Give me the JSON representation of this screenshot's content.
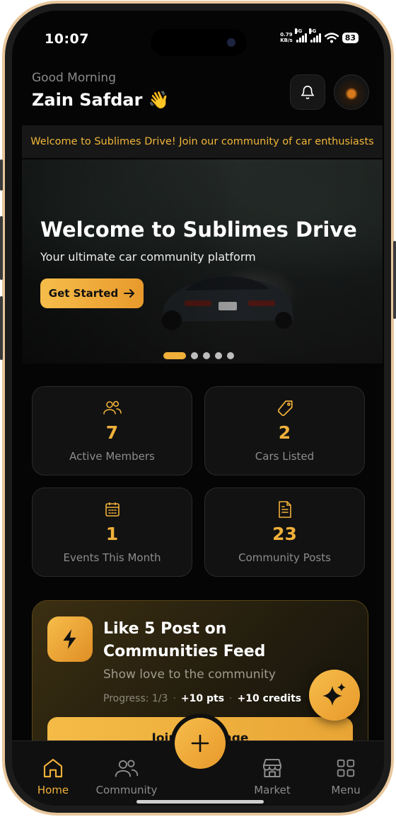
{
  "status_bar": {
    "time": "10:07",
    "speed_value": "0.79",
    "speed_unit": "KB/s",
    "network_1": "4G",
    "network_2": "4G",
    "battery": "83"
  },
  "header": {
    "greeting": "Good Morning",
    "user_name": "Zain Safdar 👋"
  },
  "ticker": {
    "text": "Welcome to Sublimes Drive! Join our community of car enthusiasts"
  },
  "hero": {
    "title": "Welcome to Sublimes Drive",
    "subtitle": "Your ultimate car community platform",
    "cta_label": "Get Started",
    "slide_count": 5,
    "active_slide": 1
  },
  "stats": [
    {
      "value": "7",
      "label": "Active Members",
      "icon": "users-icon"
    },
    {
      "value": "2",
      "label": "Cars Listed",
      "icon": "tag-icon"
    },
    {
      "value": "1",
      "label": "Events This Month",
      "icon": "calendar-icon"
    },
    {
      "value": "23",
      "label": "Community Posts",
      "icon": "document-icon"
    }
  ],
  "challenge": {
    "title": "Like 5 Post on Communities Feed",
    "subtitle": "Show love to the community",
    "progress": "Progress: 1/3",
    "separator": "·",
    "points": "+10 pts",
    "credits": "+10 credits",
    "button_label": "Join Challenge"
  },
  "bottom_nav": {
    "items": [
      {
        "label": "Home",
        "icon": "home-icon",
        "active": true
      },
      {
        "label": "Community",
        "icon": "users-icon",
        "active": false
      },
      {
        "label": "Market",
        "icon": "store-icon",
        "active": false
      },
      {
        "label": "Menu",
        "icon": "grid-icon",
        "active": false
      }
    ]
  },
  "colors": {
    "accent": "#f0b03a",
    "background": "#050505",
    "card": "#121212"
  }
}
